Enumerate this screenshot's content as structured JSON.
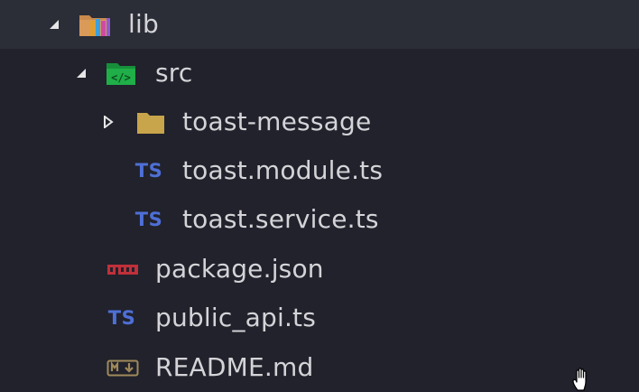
{
  "explorer": {
    "items": [
      {
        "label": "lib",
        "kind": "folder",
        "icon": "library-folder-icon",
        "expanded": true
      },
      {
        "label": "src",
        "kind": "folder",
        "icon": "source-folder-icon",
        "expanded": true
      },
      {
        "label": "toast-message",
        "kind": "folder",
        "icon": "folder-icon",
        "expanded": false
      },
      {
        "label": "toast.module.ts",
        "kind": "file",
        "icon": "typescript-icon"
      },
      {
        "label": "toast.service.ts",
        "kind": "file",
        "icon": "typescript-icon"
      },
      {
        "label": "package.json",
        "kind": "file",
        "icon": "npm-icon"
      },
      {
        "label": "public_api.ts",
        "kind": "file",
        "icon": "typescript-icon"
      },
      {
        "label": "README.md",
        "kind": "file",
        "icon": "markdown-icon"
      }
    ],
    "ts_glyph": "TS",
    "colors": {
      "background": "#21222c",
      "selected_row": "#2b2d37",
      "text": "#d4d4d8",
      "typescript": "#4e6fd6",
      "npm": "#c0303a",
      "folder": "#c8a44a",
      "src_folder": "#1fae48"
    }
  }
}
